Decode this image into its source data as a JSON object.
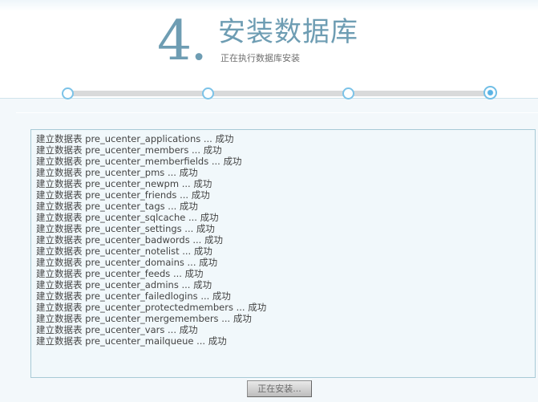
{
  "header": {
    "step_number": "4.",
    "title": "安装数据库",
    "subtitle": "正在执行数据库安装"
  },
  "progress": {
    "total_steps": 4,
    "current_step": 4
  },
  "log": {
    "lines": [
      "建立数据表 pre_ucenter_applications ... 成功",
      "建立数据表 pre_ucenter_members ... 成功",
      "建立数据表 pre_ucenter_memberfields ... 成功",
      "建立数据表 pre_ucenter_pms ... 成功",
      "建立数据表 pre_ucenter_newpm ... 成功",
      "建立数据表 pre_ucenter_friends ... 成功",
      "建立数据表 pre_ucenter_tags ... 成功",
      "建立数据表 pre_ucenter_sqlcache ... 成功",
      "建立数据表 pre_ucenter_settings ... 成功",
      "建立数据表 pre_ucenter_badwords ... 成功",
      "建立数据表 pre_ucenter_notelist ... 成功",
      "建立数据表 pre_ucenter_domains ... 成功",
      "建立数据表 pre_ucenter_feeds ... 成功",
      "建立数据表 pre_ucenter_admins ... 成功",
      "建立数据表 pre_ucenter_failedlogins ... 成功",
      "建立数据表 pre_ucenter_protectedmembers ... 成功",
      "建立数据表 pre_ucenter_mergemembers ... 成功",
      "建立数据表 pre_ucenter_vars ... 成功",
      "建立数据表 pre_ucenter_mailqueue ... 成功"
    ]
  },
  "footer": {
    "button_label": "正在安装..."
  },
  "colors": {
    "accent": "#6e9db3",
    "node_border": "#7cc3e8",
    "track": "#d9dadb"
  }
}
